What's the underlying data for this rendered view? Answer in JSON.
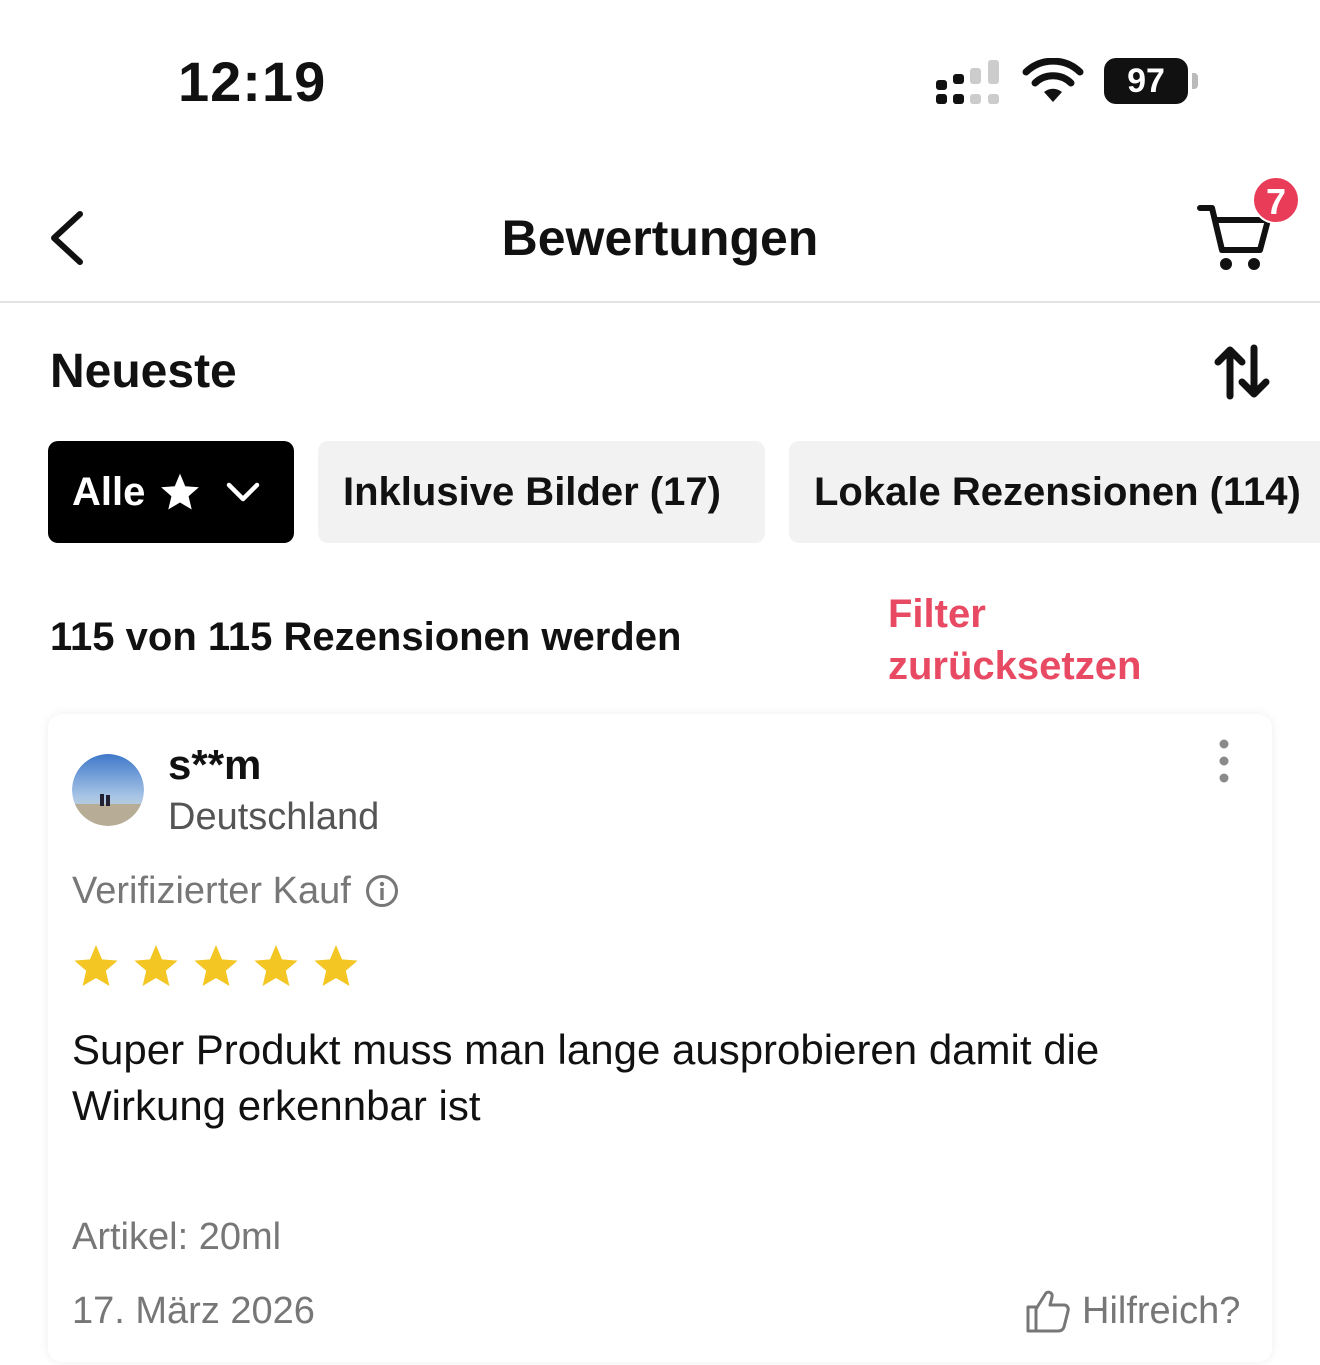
{
  "status_bar": {
    "time": "12:19",
    "battery": "97",
    "icons": [
      "cellular-signal-icon",
      "wifi-icon",
      "battery-icon"
    ]
  },
  "header": {
    "title": "Bewertungen",
    "back_icon": "chevron-left-icon",
    "cart_icon": "shopping-cart-icon",
    "cart_count": "7",
    "badge_color": "#e83c58"
  },
  "sort": {
    "label": "Neueste",
    "icon": "sort-arrows-icon"
  },
  "filters": {
    "chips": [
      {
        "label": "Alle",
        "icon": "star-icon",
        "dropdown": "chevron-down-icon",
        "selected": true
      },
      {
        "label": "Inklusive Bilder (17)",
        "selected": false
      },
      {
        "label": "Lokale Rezensionen (114)",
        "selected": false
      }
    ],
    "summary": "115 von 115 Rezensionen werden",
    "reset_label": "Filter zurücksetzen",
    "reset_color": "#e84a63"
  },
  "reviews": [
    {
      "user": "s**m",
      "country": "Deutschland",
      "verified_label": "Verifizierter Kauf",
      "rating": 5,
      "star_color": "#f3c623",
      "text": "Super Produkt muss man lange ausprobieren damit die Wirkung erkennbar ist",
      "item": "Artikel: 20ml",
      "date": "17. März 2026",
      "helpful_label": "Hilfreich?"
    }
  ]
}
